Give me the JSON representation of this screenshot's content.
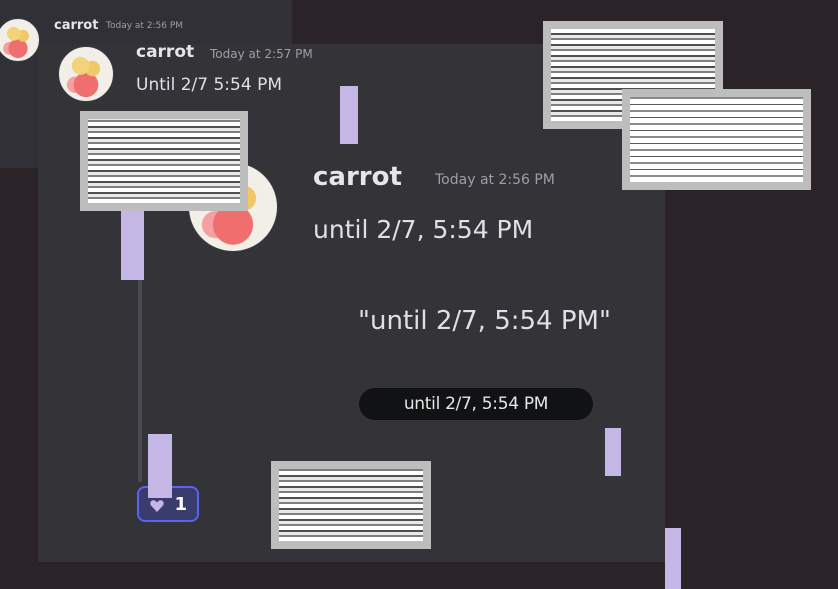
{
  "messages": [
    {
      "author": "carrot",
      "timestamp": "Today at 2:56 PM",
      "text": ""
    },
    {
      "author": "carrot",
      "timestamp": "Today at 2:57 PM",
      "text": "Until  2/7  5:54 PM"
    },
    {
      "author": "carrot",
      "timestamp": "Today at 2:56 PM",
      "text": "until 2/7, 5:54 PM"
    }
  ],
  "quoted_text": "\"until 2/7, 5:54 PM\"",
  "pill_text": "until 2/7, 5:54 PM",
  "reaction": {
    "icon": "heart-icon",
    "count": "1",
    "accent": "#5865f2"
  },
  "colors": {
    "background": "#2a2429",
    "panel": "#333338",
    "stripe": "#c5b7e5"
  }
}
